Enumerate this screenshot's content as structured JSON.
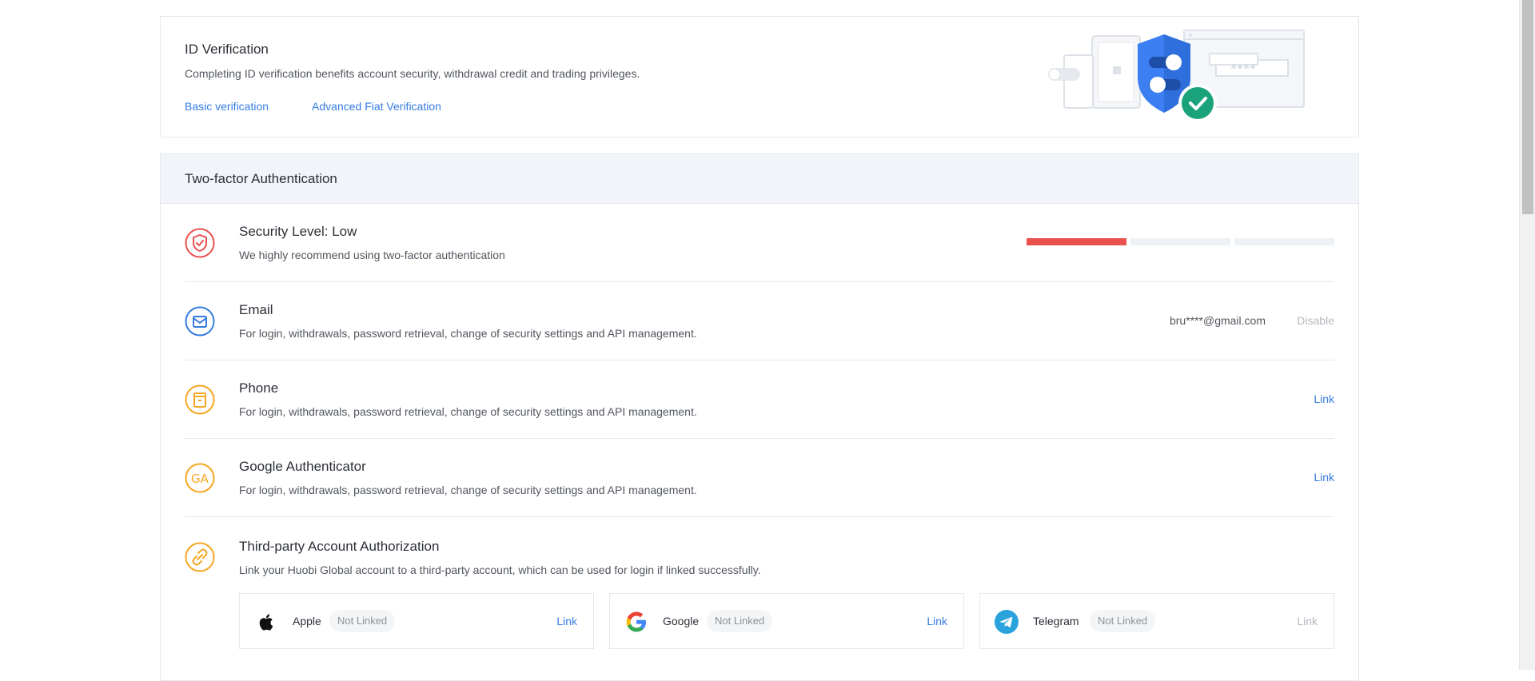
{
  "id_verification": {
    "title": "ID Verification",
    "description": "Completing ID verification benefits account security, withdrawal credit and trading privileges.",
    "basic_link": "Basic verification",
    "advanced_link": "Advanced Fiat Verification",
    "illustration_password_mask": "****"
  },
  "two_factor": {
    "header": "Two-factor Authentication",
    "security": {
      "title": "Security Level: Low",
      "description": "We highly recommend using two-factor authentication",
      "level_filled_segments": 1,
      "level_total_segments": 3,
      "level_color": "#e9514f"
    },
    "email": {
      "title": "Email",
      "description": "For login, withdrawals, password retrieval, change of security settings and API management.",
      "value": "bru****@gmail.com",
      "action": "Disable"
    },
    "phone": {
      "title": "Phone",
      "description": "For login, withdrawals, password retrieval, change of security settings and API management.",
      "action": "Link"
    },
    "google_auth": {
      "title": "Google Authenticator",
      "description": "For login, withdrawals, password retrieval, change of security settings and API management.",
      "icon_text": "GA",
      "action": "Link"
    },
    "third_party": {
      "title": "Third-party Account Authorization",
      "description": "Link your Huobi Global account to a third-party account, which can be used for login if linked successfully.",
      "accounts": [
        {
          "name": "Apple",
          "status": "Not Linked",
          "action": "Link"
        },
        {
          "name": "Google",
          "status": "Not Linked",
          "action": "Link"
        },
        {
          "name": "Telegram",
          "status": "Not Linked",
          "action": "Link"
        }
      ]
    }
  },
  "colors": {
    "accent": "#357ce1",
    "danger": "#e9514f",
    "warning": "#f5a623",
    "muted": "#b4b8be"
  }
}
